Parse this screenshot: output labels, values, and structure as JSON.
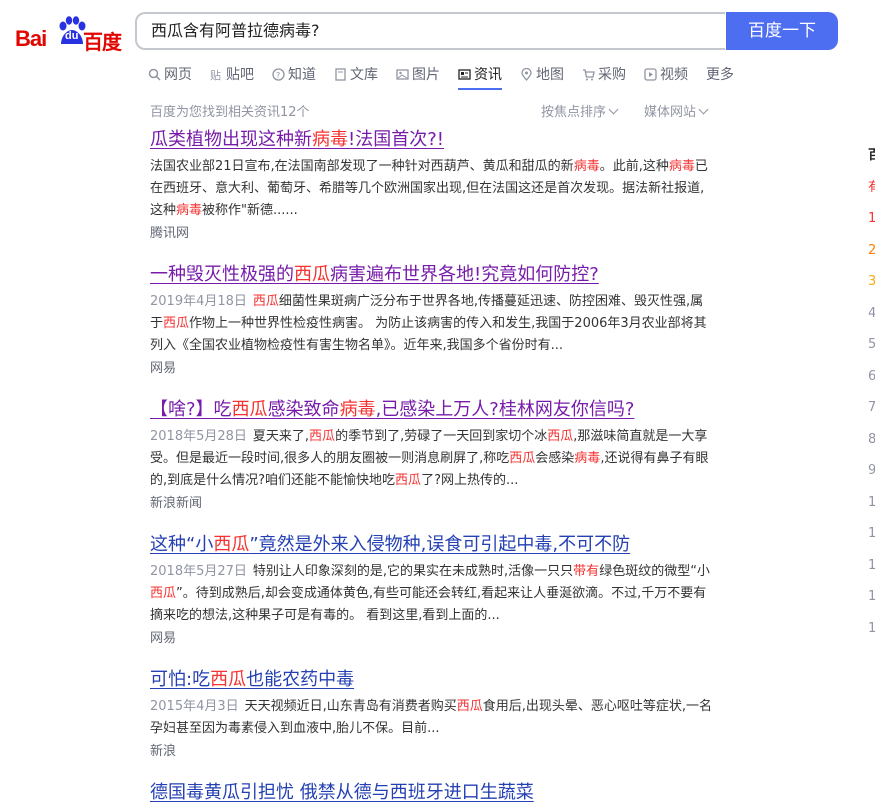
{
  "logo": {
    "left": "Bai",
    "middle": "du",
    "right": "百度"
  },
  "search": {
    "query": "西瓜含有阿普拉德病毒?",
    "button": "百度一下"
  },
  "nav": [
    {
      "label": "网页",
      "icon": "search-icon"
    },
    {
      "label": "贴吧",
      "icon": "tieba-icon"
    },
    {
      "label": "知道",
      "icon": "question-icon"
    },
    {
      "label": "文库",
      "icon": "document-icon"
    },
    {
      "label": "图片",
      "icon": "image-icon"
    },
    {
      "label": "资讯",
      "icon": "news-icon",
      "active": true
    },
    {
      "label": "地图",
      "icon": "map-icon"
    },
    {
      "label": "采购",
      "icon": "cart-icon"
    },
    {
      "label": "视频",
      "icon": "play-icon"
    },
    {
      "label": "更多",
      "icon": ""
    }
  ],
  "result_count": "百度为您找到相关资讯12个",
  "sort": {
    "focus": "按焦点排序",
    "media": "媒体网站"
  },
  "results": [
    {
      "title": [
        {
          "t": "瓜类植物出现这种新"
        },
        {
          "t": "病毒",
          "hl": true
        },
        {
          "t": "!法国首次?!"
        }
      ],
      "visited": true,
      "date": "",
      "abstract": [
        {
          "t": "法国农业部21日宣布,在法国南部发现了一种针对西葫芦、黄瓜和甜瓜的新"
        },
        {
          "t": "病毒",
          "hl": true
        },
        {
          "t": "。此前,这种"
        },
        {
          "t": "病毒",
          "hl": true
        },
        {
          "t": "已在西班牙、意大利、葡萄牙、希腊等几个欧洲国家出现,但在法国这还是首次发现。据法新社报道,这种"
        },
        {
          "t": "病毒",
          "hl": true
        },
        {
          "t": "被称作\"新德......"
        }
      ],
      "source": "腾讯网"
    },
    {
      "title": [
        {
          "t": "一种毁灭性极强的"
        },
        {
          "t": "西瓜",
          "hl": true
        },
        {
          "t": "病害遍布世界各地!究竟如何防控?"
        }
      ],
      "visited": true,
      "date": "2019年4月18日",
      "abstract": [
        {
          "t": ""
        },
        {
          "t": "西瓜",
          "hl": true
        },
        {
          "t": "细菌性果斑病广泛分布于世界各地,传播蔓延迅速、防控困难、毁灭性强,属于"
        },
        {
          "t": "西瓜",
          "hl": true
        },
        {
          "t": "作物上一种世界性检疫性病害。 为防止该病害的传入和发生,我国于2006年3月农业部将其列入《全国农业植物检疫性有害生物名单》。近年来,我国多个省份时有..."
        }
      ],
      "source": "网易"
    },
    {
      "title": [
        {
          "t": "【啥?】吃"
        },
        {
          "t": "西瓜",
          "hl": true
        },
        {
          "t": "感染致命"
        },
        {
          "t": "病毒",
          "hl": true
        },
        {
          "t": ",已感染上万人?桂林网友你信吗?"
        }
      ],
      "visited": true,
      "date": "2018年5月28日",
      "abstract": [
        {
          "t": "夏天来了,"
        },
        {
          "t": "西瓜",
          "hl": true
        },
        {
          "t": "的季节到了,劳碌了一天回到家切个冰"
        },
        {
          "t": "西瓜",
          "hl": true
        },
        {
          "t": ",那滋味简直就是一大享受。但是最近一段时间,很多人的朋友圈被一则消息刷屏了,称吃"
        },
        {
          "t": "西瓜",
          "hl": true
        },
        {
          "t": "会感染"
        },
        {
          "t": "病毒",
          "hl": true
        },
        {
          "t": ",还说得有鼻子有眼的,到底是什么情况?咱们还能不能愉快地吃"
        },
        {
          "t": "西瓜",
          "hl": true
        },
        {
          "t": "了?网上热传的..."
        }
      ],
      "source": "新浪新闻"
    },
    {
      "title": [
        {
          "t": "这种“小"
        },
        {
          "t": "西瓜",
          "hl": true
        },
        {
          "t": "”竟然是外来入侵物种,误食可引起中毒,不可不防"
        }
      ],
      "visited": false,
      "date": "2018年5月27日",
      "abstract": [
        {
          "t": "特别让人印象深刻的是,它的果实在未成熟时,活像一只只"
        },
        {
          "t": "带有",
          "hl": true
        },
        {
          "t": "绿色斑纹的微型“小"
        },
        {
          "t": "西瓜",
          "hl": true
        },
        {
          "t": "”。待到成熟后,却会变成通体黄色,有些可能还会转红,看起来让人垂涎欲滴。不过,千万不要有摘来吃的想法,这种果子可是有毒的。 看到这里,看到上面的..."
        }
      ],
      "source": "网易"
    },
    {
      "title": [
        {
          "t": "可怕:吃"
        },
        {
          "t": "西瓜",
          "hl": true
        },
        {
          "t": "也能农药中毒"
        }
      ],
      "visited": false,
      "date": "2015年4月3日",
      "abstract": [
        {
          "t": "天天视频近日,山东青岛有消费者购买"
        },
        {
          "t": "西瓜",
          "hl": true
        },
        {
          "t": "食用后,出现头晕、恶心呕吐等症状,一名孕妇甚至因为毒素侵入到血液中,胎儿不保。目前..."
        }
      ],
      "source": "新浪"
    },
    {
      "title": [
        {
          "t": "德国毒黄瓜引担忧 俄禁从德与西班牙进口生蔬菜"
        }
      ],
      "visited": false,
      "date": "",
      "abstract": [],
      "source": ""
    }
  ],
  "right_column": [
    "百",
    "有",
    "1",
    "2",
    "3",
    "4",
    "5",
    "6",
    "7",
    "8",
    "9",
    "1",
    "1",
    "1",
    "1",
    "1"
  ]
}
